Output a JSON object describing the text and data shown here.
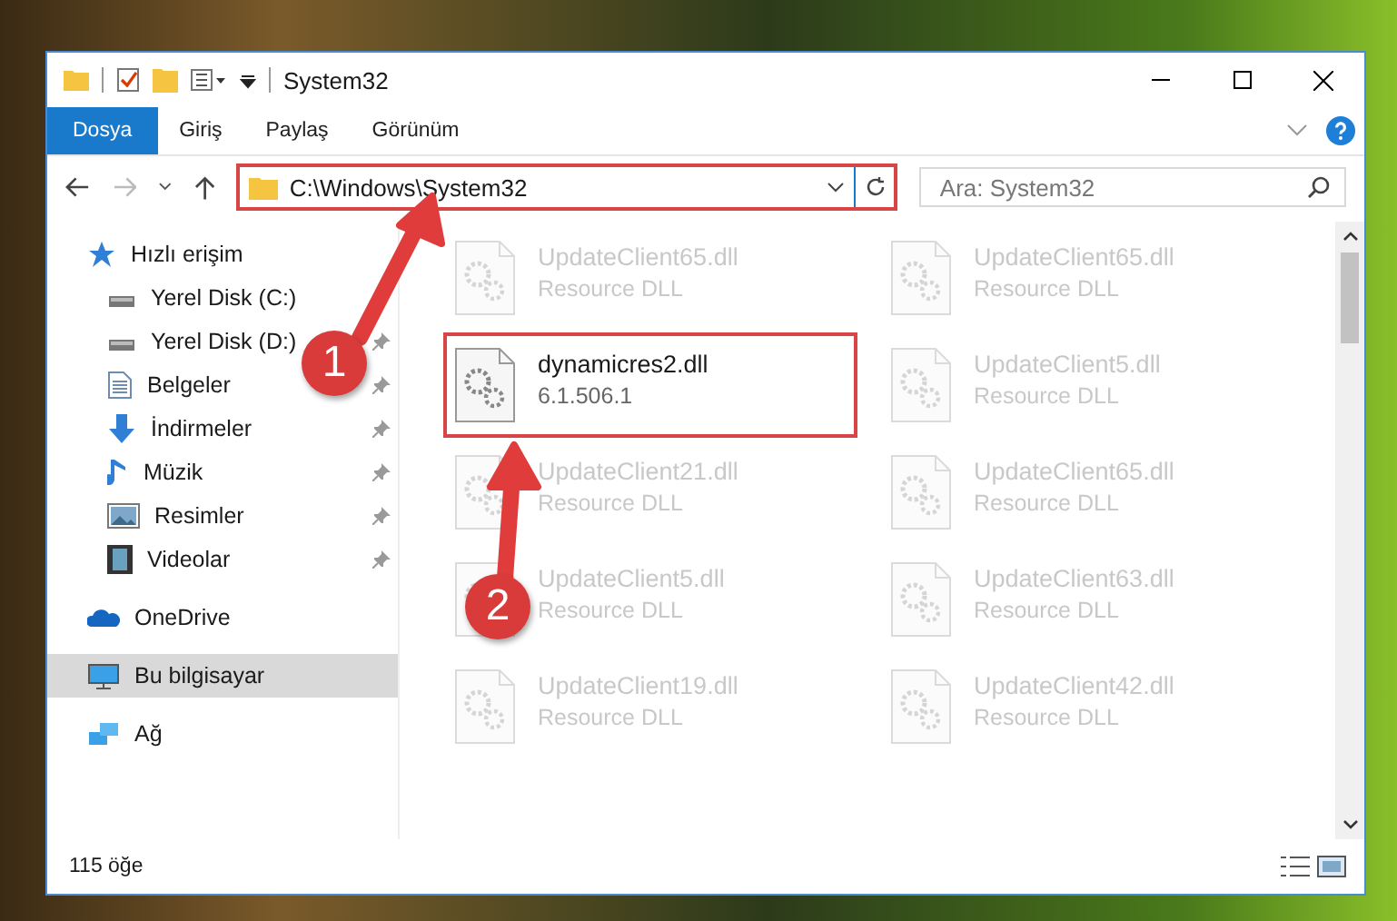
{
  "window": {
    "title": "System32"
  },
  "tabs": [
    {
      "label": "Dosya",
      "kind": "file"
    },
    {
      "label": "Giriş",
      "kind": "tab"
    },
    {
      "label": "Paylaş",
      "kind": "tab"
    },
    {
      "label": "Görünüm",
      "kind": "tab"
    }
  ],
  "address": {
    "value": "C:\\Windows\\System32",
    "highlighted": true
  },
  "search": {
    "placeholder": "Ara: System32"
  },
  "sidebar": {
    "items": [
      {
        "label": "Hızlı erişim",
        "kind": "star",
        "selected": false,
        "children": [
          {
            "label": "Yerel Disk (C:)",
            "kind": "drive"
          },
          {
            "label": "Yerel Disk (D:)",
            "kind": "drive",
            "pinned": true
          },
          {
            "label": "Belgeler",
            "kind": "docs",
            "pinned": true
          },
          {
            "label": "İndirmeler",
            "kind": "download",
            "pinned": true
          },
          {
            "label": "Müzik",
            "kind": "music",
            "pinned": true
          },
          {
            "label": "Resimler",
            "kind": "pictures",
            "pinned": true
          },
          {
            "label": "Videolar",
            "kind": "video",
            "pinned": true
          }
        ]
      },
      {
        "label": "OneDrive",
        "kind": "cloud",
        "selected": false
      },
      {
        "label": "Bu bilgisayar",
        "kind": "pc",
        "selected": true
      },
      {
        "label": "Ağ",
        "kind": "network",
        "selected": false
      }
    ]
  },
  "files": [
    {
      "name": "UpdateClient65.dll",
      "detail": "Resource DLL",
      "dimmed": true,
      "highlighted": false
    },
    {
      "name": "UpdateClient65.dll",
      "detail": "Resource DLL",
      "dimmed": true,
      "highlighted": false
    },
    {
      "name": "dynamicres2.dll",
      "detail": "6.1.506.1",
      "dimmed": false,
      "highlighted": true
    },
    {
      "name": "UpdateClient5.dll",
      "detail": "Resource DLL",
      "dimmed": true,
      "highlighted": false
    },
    {
      "name": "UpdateClient21.dll",
      "detail": "Resource DLL",
      "dimmed": true,
      "highlighted": false
    },
    {
      "name": "UpdateClient65.dll",
      "detail": "Resource DLL",
      "dimmed": true,
      "highlighted": false
    },
    {
      "name": "UpdateClient5.dll",
      "detail": "Resource DLL",
      "dimmed": true,
      "highlighted": false
    },
    {
      "name": "UpdateClient63.dll",
      "detail": "Resource DLL",
      "dimmed": true,
      "highlighted": false
    },
    {
      "name": "UpdateClient19.dll",
      "detail": "Resource DLL",
      "dimmed": true,
      "highlighted": false
    },
    {
      "name": "UpdateClient42.dll",
      "detail": "Resource DLL",
      "dimmed": true,
      "highlighted": false
    }
  ],
  "status_bar": {
    "count": "115 öğe"
  },
  "annotations": [
    {
      "number": "1"
    },
    {
      "number": "2"
    }
  ]
}
